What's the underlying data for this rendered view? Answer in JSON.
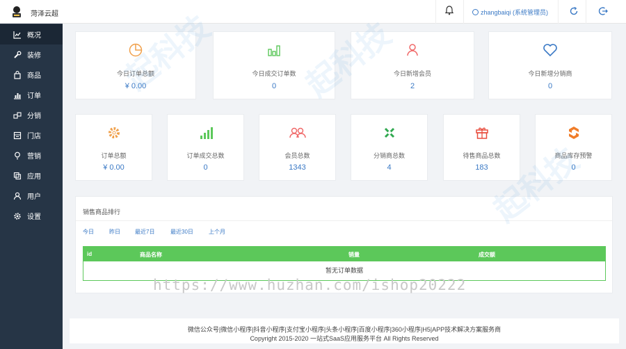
{
  "header": {
    "shop_name": "菏泽云超",
    "user_label": "zhangbaiqi (系统管理员)",
    "icons": [
      "bell-icon",
      "user-check-icon",
      "refresh-icon",
      "logout-icon"
    ]
  },
  "sidebar": {
    "items": [
      {
        "label": "概况",
        "icon": "chart-line-icon"
      },
      {
        "label": "装修",
        "icon": "wrench-icon"
      },
      {
        "label": "商品",
        "icon": "bag-icon"
      },
      {
        "label": "订单",
        "icon": "bar-chart-icon"
      },
      {
        "label": "分销",
        "icon": "share-icon"
      },
      {
        "label": "门店",
        "icon": "store-icon"
      },
      {
        "label": "营销",
        "icon": "bulb-icon"
      },
      {
        "label": "应用",
        "icon": "copy-icon"
      },
      {
        "label": "用户",
        "icon": "user-icon"
      },
      {
        "label": "设置",
        "icon": "gear-icon"
      }
    ],
    "active_index": 0
  },
  "today_stats": [
    {
      "label": "今日订单总额",
      "value": "¥ 0.00",
      "icon": "pie-icon",
      "color": "#f0a04b"
    },
    {
      "label": "今日成交订单数",
      "value": "0",
      "icon": "bars-icon",
      "color": "#5cc85a"
    },
    {
      "label": "今日新增会员",
      "value": "2",
      "icon": "person-icon",
      "color": "#f06a6a"
    },
    {
      "label": "今日新增分销商",
      "value": "0",
      "icon": "heart-icon",
      "color": "#3a79c5"
    }
  ],
  "total_stats": [
    {
      "label": "订单总额",
      "value": "¥ 0.00",
      "icon": "cog-icon",
      "color": "#f0a04b"
    },
    {
      "label": "订单成交总数",
      "value": "0",
      "icon": "signal-icon",
      "color": "#5cc85a"
    },
    {
      "label": "会员总数",
      "value": "1343",
      "icon": "group-icon",
      "color": "#f06a6a"
    },
    {
      "label": "分销商总数",
      "value": "4",
      "icon": "joomla-icon",
      "color": "#2fa84f"
    },
    {
      "label": "待售商品总数",
      "value": "183",
      "icon": "gift-icon",
      "color": "#e84c3d"
    },
    {
      "label": "商品库存预警",
      "value": "0",
      "icon": "hex-icon",
      "color": "#f07d2a"
    }
  ],
  "ranking": {
    "title": "销售商品排行",
    "tabs": [
      "今日",
      "昨日",
      "最近7日",
      "最近30日",
      "上个月"
    ],
    "columns": [
      "id",
      "商品名称",
      "销量",
      "成交额"
    ],
    "empty_text": "暂无订单数据"
  },
  "footer": {
    "line1": "微信公众号|微信小程序|抖音小程序|支付宝小程序|头条小程序|百度小程序|360小程序|H5|APP技术解决方案服务商",
    "line2": "Copyright 2015-2020 一站式SaaS应用服务平台 All Rights Reserved"
  },
  "watermark": {
    "url": "https://www.huzhan.com/ishop20222",
    "brand": "起科技"
  }
}
